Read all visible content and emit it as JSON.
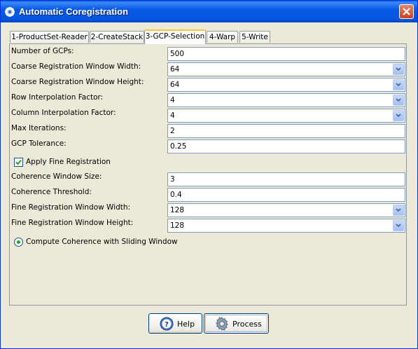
{
  "window": {
    "title": "Automatic Coregistration"
  },
  "tabs": [
    {
      "label": "1-ProductSet-Reader"
    },
    {
      "label": "2-CreateStack"
    },
    {
      "label": "3-GCP-Selection"
    },
    {
      "label": "4-Warp"
    },
    {
      "label": "5-Write"
    }
  ],
  "active_tab": "3-GCP-Selection",
  "form": {
    "num_gcps": {
      "label": "Number of GCPs:",
      "value": "500"
    },
    "coarse_width": {
      "label": "Coarse Registration Window Width:",
      "value": "64"
    },
    "coarse_height": {
      "label": "Coarse Registration Window Height:",
      "value": "64"
    },
    "row_interp": {
      "label": "Row Interpolation Factor:",
      "value": "4"
    },
    "col_interp": {
      "label": "Column Interpolation Factor:",
      "value": "4"
    },
    "max_iter": {
      "label": "Max Iterations:",
      "value": "2"
    },
    "gcp_tol": {
      "label": "GCP Tolerance:",
      "value": "0.25"
    },
    "apply_fine": {
      "label": "Apply Fine Registration",
      "checked": true
    },
    "coh_window": {
      "label": "Coherence Window Size:",
      "value": "3"
    },
    "coh_thresh": {
      "label": "Coherence Threshold:",
      "value": "0.4"
    },
    "fine_width": {
      "label": "Fine Registration Window Width:",
      "value": "128"
    },
    "fine_height": {
      "label": "Fine Registration Window Height:",
      "value": "128"
    },
    "sliding": {
      "label": "Compute Coherence with Sliding Window",
      "selected": true
    }
  },
  "buttons": {
    "help": "Help",
    "process": "Process"
  }
}
